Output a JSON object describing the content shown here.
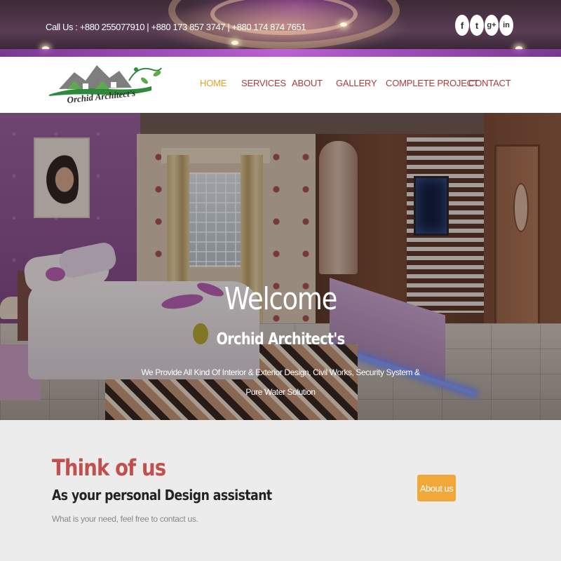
{
  "topbar": {
    "call_us": "Call Us : +880 255077910 | +880 173 857 3747 | +880 174 874 7651",
    "social": [
      {
        "icon": "facebook-icon",
        "glyph": "f"
      },
      {
        "icon": "twitter-icon",
        "glyph": "t"
      },
      {
        "icon": "google-plus-icon",
        "glyph": "g+"
      },
      {
        "icon": "linkedin-icon",
        "glyph": "in"
      }
    ]
  },
  "brand": {
    "logo_text": "Orchid Architect's"
  },
  "nav": {
    "items": [
      {
        "label": "HOME",
        "active": true
      },
      {
        "label": "SERVICES"
      },
      {
        "label": "ABOUT"
      },
      {
        "label": "GALLERY"
      },
      {
        "label": "COMPLETE PROJECT"
      },
      {
        "label": "CONTACT"
      }
    ]
  },
  "hero": {
    "title": "Welcome",
    "subtitle": "Orchid Architect's",
    "description": "We Provide All Kind Of Interior & Exterior Design, Civil Works, Security System & Pure Water Solution"
  },
  "intro": {
    "heading": "Think of us",
    "subheading": "As your personal Design assistant",
    "text": "What is your need, feel free to contact us.",
    "button_label": "About us"
  },
  "colors": {
    "accent_orange": "#f0a83a",
    "nav_red": "#a83c3c",
    "heading_red": "#c0504d",
    "active_nav": "#e6a020"
  }
}
